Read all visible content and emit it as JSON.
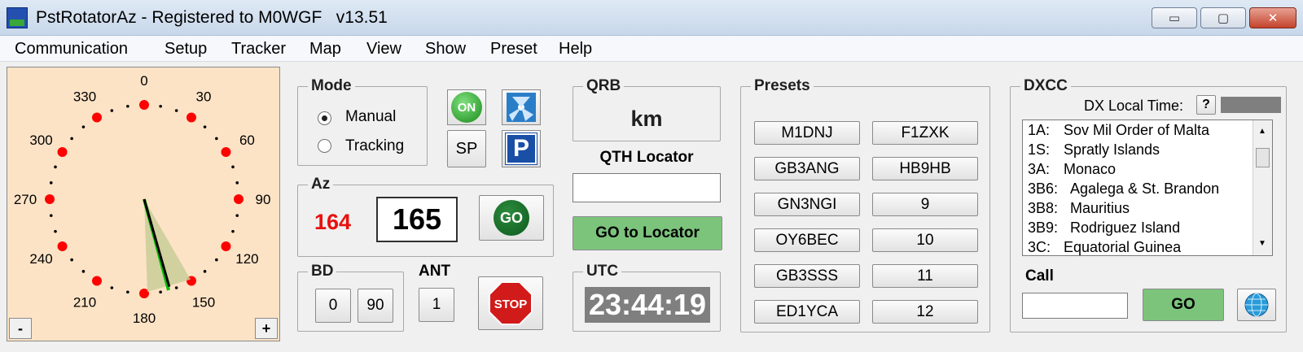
{
  "window": {
    "title": "PstRotatorAz - Registered to M0WGF   v13.51",
    "controls": {
      "minimize": "▭",
      "maximize": "▢",
      "close": "✕"
    }
  },
  "menu": [
    "Communication",
    "Setup",
    "Tracker",
    "Map",
    "View",
    "Show",
    "Preset",
    "Help"
  ],
  "dial": {
    "labels": [
      "0",
      "30",
      "60",
      "90",
      "120",
      "150",
      "180",
      "210",
      "240",
      "270",
      "300",
      "330"
    ],
    "azimuth_deg": 164,
    "minus": "-",
    "plus": "+",
    "colors": {
      "background": "#fde3c6",
      "dot": "#ff0000",
      "needle": "#00c000"
    }
  },
  "mode": {
    "title": "Mode",
    "options": [
      {
        "label": "Manual",
        "selected": true
      },
      {
        "label": "Tracking",
        "selected": false
      }
    ],
    "on_button": "ON",
    "sp_button": "SP",
    "park_button": "P"
  },
  "az": {
    "title": "Az",
    "current": "164",
    "target": "165",
    "go": "GO",
    "current_color": "#ff0000"
  },
  "bd": {
    "title": "BD",
    "buttons": [
      "0",
      "90"
    ]
  },
  "ant": {
    "title": "ANT",
    "value": "1"
  },
  "stop": {
    "label": "STOP"
  },
  "qrb": {
    "title": "QRB",
    "unit": "km"
  },
  "qth": {
    "label": "QTH Locator",
    "value": "",
    "go": "GO to Locator"
  },
  "utc": {
    "title": "UTC",
    "time": "23:44:19"
  },
  "presets": {
    "title": "Presets",
    "left": [
      "M1DNJ",
      "GB3ANG",
      "GN3NGI",
      "OY6BEC",
      "GB3SSS",
      "ED1YCA"
    ],
    "right": [
      "F1ZXK",
      "HB9HB",
      "9",
      "10",
      "11",
      "12"
    ]
  },
  "dxcc": {
    "title": "DXCC",
    "local_time_label": "DX Local Time:",
    "help": "?",
    "list": [
      {
        "code": "1A:",
        "name": "Sov Mil Order of Malta"
      },
      {
        "code": "1S:",
        "name": "Spratly Islands"
      },
      {
        "code": "3A:",
        "name": "Monaco"
      },
      {
        "code": "3B6:",
        "name": "Agalega & St. Brandon"
      },
      {
        "code": "3B8:",
        "name": "Mauritius"
      },
      {
        "code": "3B9:",
        "name": "Rodriguez Island"
      },
      {
        "code": "3C:",
        "name": "Equatorial Guinea"
      }
    ],
    "call_label": "Call",
    "call_value": "",
    "go": "GO"
  },
  "accent": {
    "green_button": "#7cc47c",
    "utc_bg": "#7f7f7f"
  }
}
